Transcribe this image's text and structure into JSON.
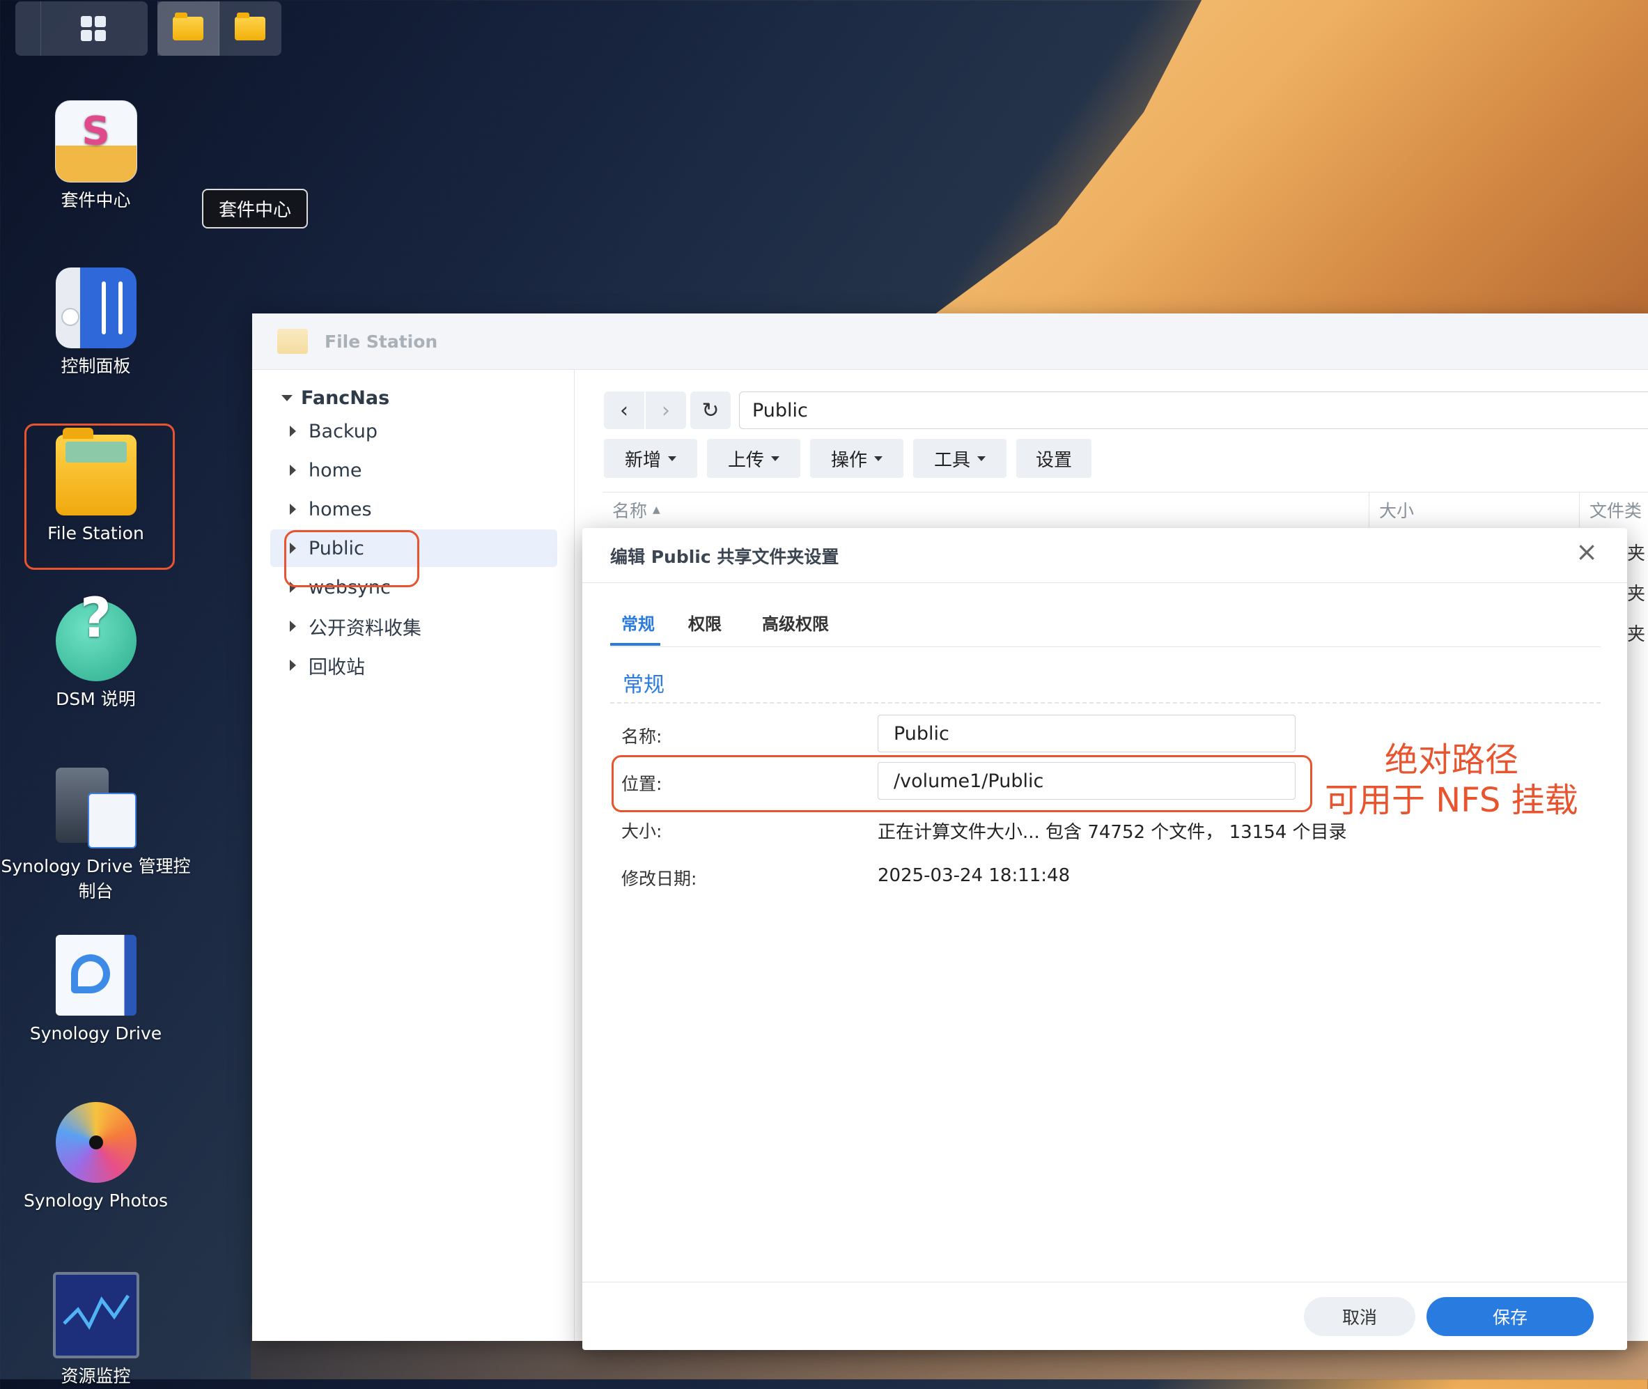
{
  "desktop": {
    "icons": [
      {
        "label": "套件中心",
        "icon": "package-center-icon"
      },
      {
        "label": "控制面板",
        "icon": "control-panel-icon"
      },
      {
        "label": "File Station",
        "icon": "file-station-icon"
      },
      {
        "label": "DSM 说明",
        "icon": "help-icon"
      },
      {
        "label": "Synology Drive 管理控制台",
        "icon": "drive-admin-icon"
      },
      {
        "label": "Synology Drive",
        "icon": "drive-icon"
      },
      {
        "label": "Synology Photos",
        "icon": "photos-icon"
      },
      {
        "label": "资源监控",
        "icon": "resource-monitor-icon"
      }
    ],
    "tooltip": "套件中心"
  },
  "file_station": {
    "title": "File Station",
    "tree": {
      "root": "FancNas",
      "items": [
        "Backup",
        "home",
        "homes",
        "Public",
        "websync",
        "公开资料收集",
        "回收站"
      ],
      "selected": "Public"
    },
    "path": "Public",
    "toolbar": {
      "add": "新增",
      "upload": "上传",
      "action": "操作",
      "tools": "工具",
      "settings": "设置"
    },
    "columns": {
      "name": "名称",
      "size": "大小",
      "type": "文件类"
    },
    "row_type_fragment": "夹"
  },
  "dialog": {
    "title": "编辑 Public 共享文件夹设置",
    "tabs": [
      "常规",
      "权限",
      "高级权限"
    ],
    "active_tab": "常规",
    "section": "常规",
    "fields": {
      "name_label": "名称:",
      "name_value": "Public",
      "location_label": "位置:",
      "location_value": "/volume1/Public",
      "size_label": "大小:",
      "size_value": "正在计算文件大小... 包含 74752 个文件， 13154 个目录",
      "modified_label": "修改日期:",
      "modified_value": "2025-03-24 18:11:48"
    },
    "annotation_line1": "绝对路径",
    "annotation_line2": "可用于 NFS 挂载",
    "cancel": "取消",
    "save": "保存"
  },
  "colors": {
    "accent": "#2a7be0",
    "highlight": "#e8542e"
  }
}
